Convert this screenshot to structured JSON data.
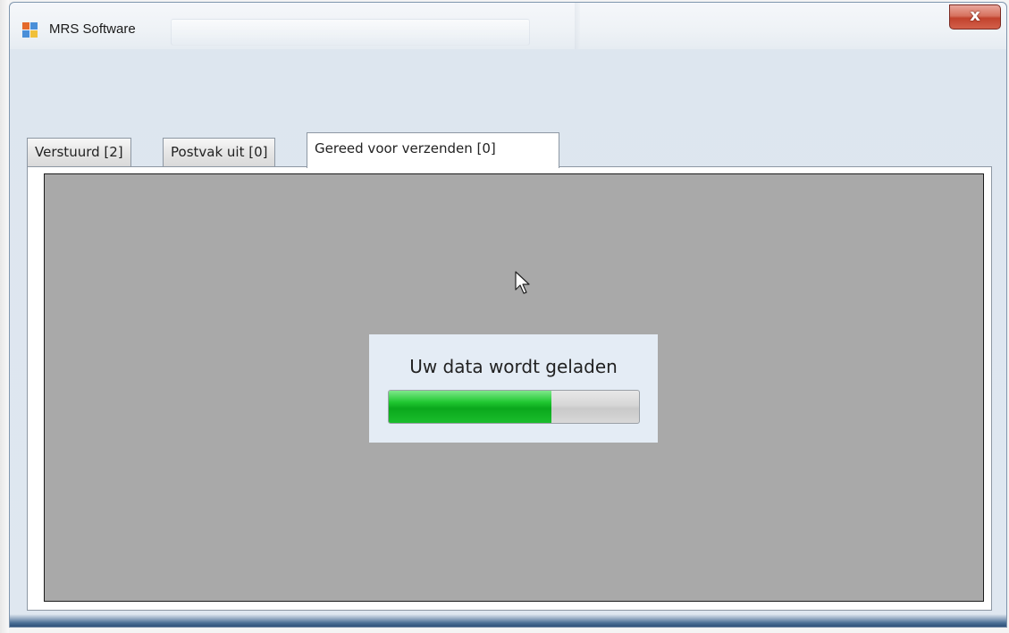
{
  "window": {
    "title": "MRS Software",
    "close_glyph": "x"
  },
  "tabs": [
    {
      "label": "Verstuurd [2]",
      "active": false
    },
    {
      "label": "Postvak uit [0]",
      "active": false
    },
    {
      "label": "Gereed voor verzenden [0]",
      "active": true
    }
  ],
  "loading": {
    "message": "Uw data wordt geladen",
    "progress": 0.65
  },
  "icons": {
    "app": "app-icon",
    "close": "close-icon",
    "cursor": "mouse-pointer-icon"
  },
  "colors": {
    "content_background": "#a9a9a9",
    "progress_fill": "#0aa81c",
    "close_button": "#c2422d"
  }
}
